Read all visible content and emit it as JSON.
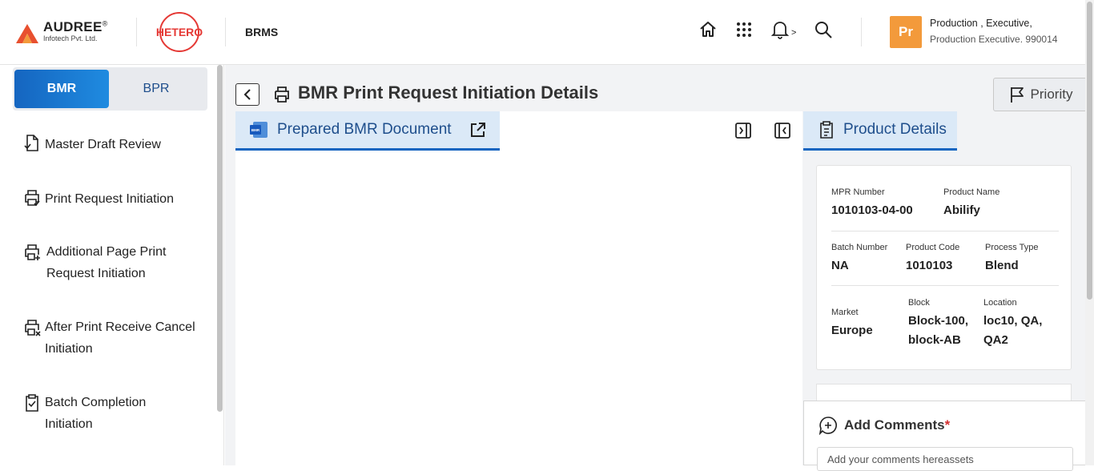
{
  "header": {
    "company_name": "AUDREE",
    "company_reg": "®",
    "company_sub": "Infotech Pvt. Ltd.",
    "client_logo_text": "HETERO",
    "app_name": "BRMS",
    "icons": [
      "home-icon",
      "apps-grid-icon",
      "bell-icon",
      "search-icon"
    ],
    "notification_suffix": ">",
    "user": {
      "initials": "Pr",
      "name": "Production , Executive,",
      "role": "Production Executive. 990014",
      "avatar_color": "#f39a3b"
    }
  },
  "sidebar": {
    "segments": [
      {
        "label": "BMR",
        "active": true
      },
      {
        "label": "BPR",
        "active": false
      }
    ],
    "items": [
      {
        "label_lines": [
          "Master Draft Review"
        ],
        "icon": "document-check-icon"
      },
      {
        "label_lines": [
          "Print Request Initiation"
        ],
        "icon": "printer-check-icon"
      },
      {
        "label_lines": [
          "Additional Page Print",
          "Request Initiation"
        ],
        "icon": "printer-plus-icon"
      },
      {
        "label_lines": [
          "After Print Receive Cancel",
          "Initiation"
        ],
        "icon": "printer-x-icon"
      },
      {
        "label_lines": [
          "Batch Completion",
          "Initiation"
        ],
        "icon": "clipboard-check-icon"
      }
    ]
  },
  "main": {
    "title": "BMR Print Request Initiation Details",
    "priority_label": "Priority",
    "document_tab": {
      "label": "Prepared BMR Document",
      "file_icon_text": "BMR"
    },
    "product_tab": {
      "label": "Product Details"
    },
    "product": {
      "mpr_number_label": "MPR Number",
      "mpr_number": "1010103-04-00",
      "product_name_label": "Product Name",
      "product_name": "Abilify",
      "batch_number_label": "Batch Number",
      "batch_number": "NA",
      "product_code_label": "Product Code",
      "product_code": "1010103",
      "process_type_label": "Process Type",
      "process_type": "Blend",
      "market_label": "Market",
      "market": "Europe",
      "block_label": "Block",
      "block_lines": [
        "Block-100,",
        "block-AB"
      ],
      "location_label": "Location",
      "location_lines": [
        "loc10, QA,",
        "QA2"
      ]
    },
    "comments": {
      "title": "Add Comments",
      "required_mark": "*",
      "placeholder": "Add your comments hereassets"
    }
  },
  "colors": {
    "accent": "#1565c0",
    "tab_bg": "#dbe9f7",
    "main_bg": "#f2f3f5"
  }
}
